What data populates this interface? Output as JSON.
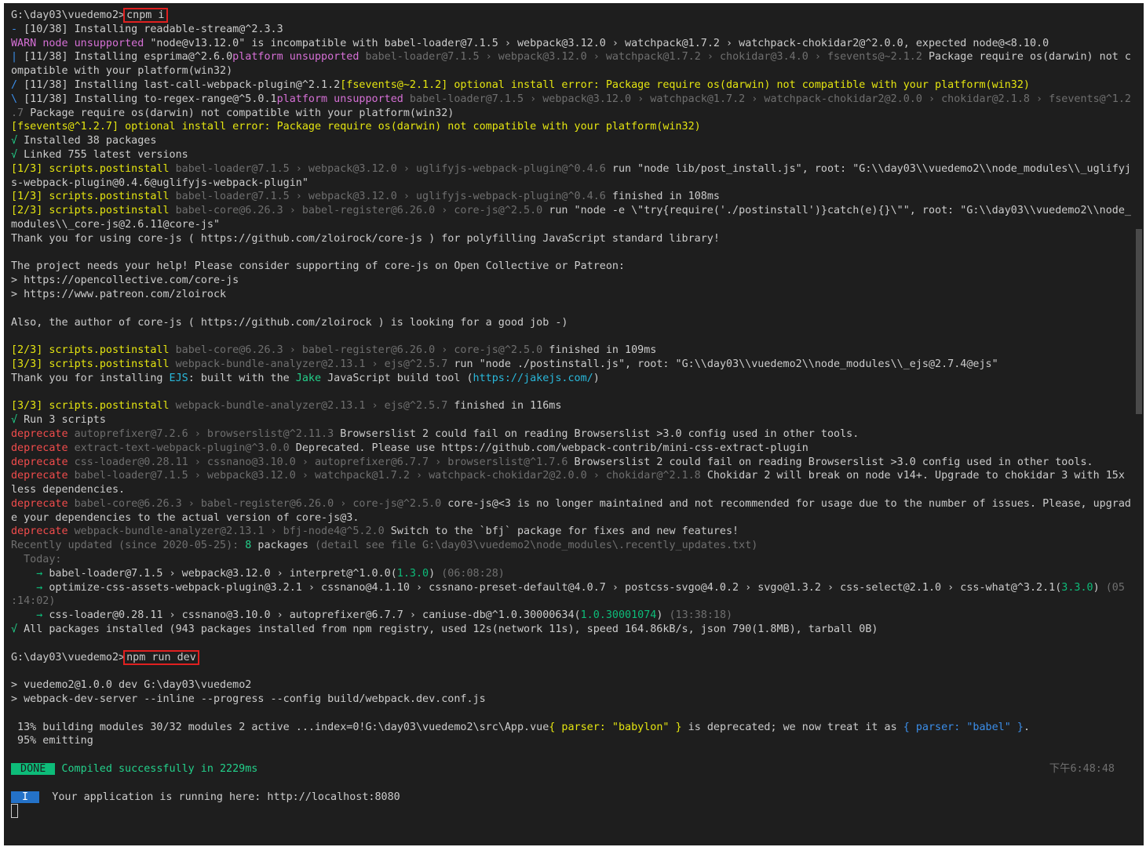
{
  "terminal": {
    "lines": [
      [
        {
          "t": "G:\\day03\\vuedemo2>",
          "c": "w"
        },
        {
          "t": "cnpm i",
          "c": "w",
          "box": true
        }
      ],
      [
        {
          "t": "- ",
          "c": "b"
        },
        {
          "t": "[10/38] Installing readable-stream@^2.3.3",
          "c": "w"
        }
      ],
      [
        {
          "t": "WARN ",
          "c": "m"
        },
        {
          "t": "node ",
          "c": "m"
        },
        {
          "t": "unsupported ",
          "c": "m"
        },
        {
          "t": "\"node@v13.12.0\" is incompatible with babel-loader@7.1.5 › webpack@3.12.0 › watchpack@1.7.2 › watchpack-chokidar2@^2.0.0, expected node@<8.10.0",
          "c": "w"
        }
      ],
      [
        {
          "t": "| ",
          "c": "b"
        },
        {
          "t": "[11/38] Installing esprima@^2.6.0",
          "c": "w"
        },
        {
          "t": "platform unsupported ",
          "c": "m"
        },
        {
          "t": "babel-loader@7.1.5 › webpack@3.12.0 › watchpack@1.7.2 › chokidar@3.4.0 › fsevents@~2.1.2 ",
          "c": "gr"
        },
        {
          "t": "Package require os(darwin) not c",
          "c": "w"
        }
      ],
      [
        {
          "t": "ompatible with your platform(win32)",
          "c": "w"
        }
      ],
      [
        {
          "t": "/ ",
          "c": "b"
        },
        {
          "t": "[11/38] Installing last-call-webpack-plugin@^2.1.2",
          "c": "w"
        },
        {
          "t": "[fsevents@~2.1.2] optional install error: Package require os(darwin) not compatible with your platform(win32)",
          "c": "y"
        }
      ],
      [
        {
          "t": "\\ ",
          "c": "b"
        },
        {
          "t": "[11/38] Installing to-regex-range@^5.0.1",
          "c": "w"
        },
        {
          "t": "platform unsupported ",
          "c": "m"
        },
        {
          "t": "babel-loader@7.1.5 › webpack@3.12.0 › watchpack@1.7.2 › watchpack-chokidar2@2.0.0 › chokidar@2.1.8 › fsevents@^1.2",
          "c": "gr"
        }
      ],
      [
        {
          "t": ".7 ",
          "c": "gr"
        },
        {
          "t": "Package require os(darwin) not compatible with your platform(win32)",
          "c": "w"
        }
      ],
      [
        {
          "t": "[fsevents@^1.2.7] optional install error: Package require os(darwin) not compatible with your platform(win32)",
          "c": "y"
        }
      ],
      [
        {
          "t": "√ ",
          "c": "g"
        },
        {
          "t": "Installed 38 packages",
          "c": "w"
        }
      ],
      [
        {
          "t": "√ ",
          "c": "g"
        },
        {
          "t": "Linked 755 latest versions",
          "c": "w"
        }
      ],
      [
        {
          "t": "[1/3] scripts.postinstall ",
          "c": "y"
        },
        {
          "t": "babel-loader@7.1.5 › webpack@3.12.0 › uglifyjs-webpack-plugin@^0.4.6 ",
          "c": "gr"
        },
        {
          "t": "run \"node lib/post_install.js\", root: \"G:\\\\day03\\\\vuedemo2\\\\node_modules\\\\_uglifyj",
          "c": "w"
        }
      ],
      [
        {
          "t": "s-webpack-plugin@0.4.6@uglifyjs-webpack-plugin\"",
          "c": "w"
        }
      ],
      [
        {
          "t": "[1/3] scripts.postinstall ",
          "c": "y"
        },
        {
          "t": "babel-loader@7.1.5 › webpack@3.12.0 › uglifyjs-webpack-plugin@^0.4.6 ",
          "c": "gr"
        },
        {
          "t": "finished in 108ms",
          "c": "w"
        }
      ],
      [
        {
          "t": "[2/3] scripts.postinstall ",
          "c": "y"
        },
        {
          "t": "babel-core@6.26.3 › babel-register@6.26.0 › core-js@^2.5.0 ",
          "c": "gr"
        },
        {
          "t": "run \"node -e \\\"try{require('./postinstall')}catch(e){}\\\"\", root: \"G:\\\\day03\\\\vuedemo2\\\\node_",
          "c": "w"
        }
      ],
      [
        {
          "t": "modules\\\\_core-js@2.6.11@core-js\"",
          "c": "w"
        }
      ],
      [
        {
          "t": "Thank you for using core-js ( https://github.com/zloirock/core-js ) for polyfilling JavaScript standard library!",
          "c": "w"
        }
      ],
      [],
      [
        {
          "t": "The project needs your help! Please consider supporting of core-js on Open Collective or Patreon:",
          "c": "w"
        }
      ],
      [
        {
          "t": "> https://opencollective.com/core-js",
          "c": "w"
        }
      ],
      [
        {
          "t": "> https://www.patreon.com/zloirock",
          "c": "w"
        }
      ],
      [],
      [
        {
          "t": "Also, the author of core-js ( https://github.com/zloirock ) is looking for a good job -)",
          "c": "w"
        }
      ],
      [],
      [
        {
          "t": "[2/3] scripts.postinstall ",
          "c": "y"
        },
        {
          "t": "babel-core@6.26.3 › babel-register@6.26.0 › core-js@^2.5.0 ",
          "c": "gr"
        },
        {
          "t": "finished in 109ms",
          "c": "w"
        }
      ],
      [
        {
          "t": "[3/3] scripts.postinstall ",
          "c": "y"
        },
        {
          "t": "webpack-bundle-analyzer@2.13.1 › ejs@^2.5.7 ",
          "c": "gr"
        },
        {
          "t": "run \"node ./postinstall.js\", root: \"G:\\\\day03\\\\vuedemo2\\\\node_modules\\\\_ejs@2.7.4@ejs\"",
          "c": "w"
        }
      ],
      [
        {
          "t": "Thank you for installing ",
          "c": "w"
        },
        {
          "t": "EJS",
          "c": "c"
        },
        {
          "t": ": built with the ",
          "c": "w"
        },
        {
          "t": "Jake",
          "c": "g"
        },
        {
          "t": " JavaScript build tool (",
          "c": "w"
        },
        {
          "t": "https://jakejs.com/",
          "c": "c"
        },
        {
          "t": ")",
          "c": "w"
        }
      ],
      [],
      [
        {
          "t": "[3/3] scripts.postinstall ",
          "c": "y"
        },
        {
          "t": "webpack-bundle-analyzer@2.13.1 › ejs@^2.5.7 ",
          "c": "gr"
        },
        {
          "t": "finished in 116ms",
          "c": "w"
        }
      ],
      [
        {
          "t": "√ ",
          "c": "g"
        },
        {
          "t": "Run 3 scripts",
          "c": "w"
        }
      ],
      [
        {
          "t": "deprecate ",
          "c": "r"
        },
        {
          "t": "autoprefixer@7.2.6 › browserslist@^2.11.3 ",
          "c": "gr"
        },
        {
          "t": "Browserslist 2 could fail on reading Browserslist >3.0 config used in other tools.",
          "c": "w"
        }
      ],
      [
        {
          "t": "deprecate ",
          "c": "r"
        },
        {
          "t": "extract-text-webpack-plugin@^3.0.0 ",
          "c": "gr"
        },
        {
          "t": "Deprecated. Please use https://github.com/webpack-contrib/mini-css-extract-plugin",
          "c": "w"
        }
      ],
      [
        {
          "t": "deprecate ",
          "c": "r"
        },
        {
          "t": "css-loader@0.28.11 › cssnano@3.10.0 › autoprefixer@6.7.7 › browserslist@^1.7.6 ",
          "c": "gr"
        },
        {
          "t": "Browserslist 2 could fail on reading Browserslist >3.0 config used in other tools.",
          "c": "w"
        }
      ],
      [
        {
          "t": "deprecate ",
          "c": "r"
        },
        {
          "t": "babel-loader@7.1.5 › webpack@3.12.0 › watchpack@1.7.2 › watchpack-chokidar2@2.0.0 › chokidar@^2.1.8 ",
          "c": "gr"
        },
        {
          "t": "Chokidar 2 will break on node v14+. Upgrade to chokidar 3 with 15x",
          "c": "w"
        }
      ],
      [
        {
          "t": "less dependencies.",
          "c": "w"
        }
      ],
      [
        {
          "t": "deprecate ",
          "c": "r"
        },
        {
          "t": "babel-core@6.26.3 › babel-register@6.26.0 › core-js@^2.5.0 ",
          "c": "gr"
        },
        {
          "t": "core-js@<3 is no longer maintained and not recommended for usage due to the number of issues. Please, upgrad",
          "c": "w"
        }
      ],
      [
        {
          "t": "e your dependencies to the actual version of core-js@3.",
          "c": "w"
        }
      ],
      [
        {
          "t": "deprecate ",
          "c": "r"
        },
        {
          "t": "webpack-bundle-analyzer@2.13.1 › bfj-node4@^5.2.0 ",
          "c": "gr"
        },
        {
          "t": "Switch to the `bfj` package for fixes and new features!",
          "c": "w"
        }
      ],
      [
        {
          "t": "Recently updated (since 2020-05-25): ",
          "c": "gr"
        },
        {
          "t": "8",
          "c": "g"
        },
        {
          "t": " packages ",
          "c": "w"
        },
        {
          "t": "(detail see file G:\\day03\\vuedemo2\\node_modules\\.recently_updates.txt)",
          "c": "gr"
        }
      ],
      [
        {
          "t": "  Today:",
          "c": "gr"
        }
      ],
      [
        {
          "t": "    → ",
          "c": "dg"
        },
        {
          "t": "babel-loader@7.1.5 › webpack@3.12.0 › interpret@^1.0.0(",
          "c": "w"
        },
        {
          "t": "1.3.0",
          "c": "dg"
        },
        {
          "t": ") ",
          "c": "w"
        },
        {
          "t": "(06:08:28)",
          "c": "gr"
        }
      ],
      [
        {
          "t": "    → ",
          "c": "dg"
        },
        {
          "t": "optimize-css-assets-webpack-plugin@3.2.1 › cssnano@4.1.10 › cssnano-preset-default@4.0.7 › postcss-svgo@4.0.2 › svgo@1.3.2 › css-select@2.1.0 › css-what@^3.2.1(",
          "c": "w"
        },
        {
          "t": "3.3.0",
          "c": "dg"
        },
        {
          "t": ") ",
          "c": "w"
        },
        {
          "t": "(05",
          "c": "gr"
        }
      ],
      [
        {
          "t": ":14:02)",
          "c": "gr"
        }
      ],
      [
        {
          "t": "    → ",
          "c": "dg"
        },
        {
          "t": "css-loader@0.28.11 › cssnano@3.10.0 › autoprefixer@6.7.7 › caniuse-db@^1.0.30000634(",
          "c": "w"
        },
        {
          "t": "1.0.30001074",
          "c": "dg"
        },
        {
          "t": ") ",
          "c": "w"
        },
        {
          "t": "(13:38:18)",
          "c": "gr"
        }
      ],
      [
        {
          "t": "√ ",
          "c": "g"
        },
        {
          "t": "All packages installed (943 packages installed from npm registry, used 12s(network 11s), speed 164.86kB/s, json 790(1.8MB), tarball 0B)",
          "c": "w"
        }
      ],
      [],
      [
        {
          "t": "G:\\day03\\vuedemo2>",
          "c": "w"
        },
        {
          "t": "npm run dev",
          "c": "w",
          "box": true
        }
      ],
      [],
      [
        {
          "t": "> vuedemo2@1.0.0 dev G:\\day03\\vuedemo2",
          "c": "w"
        }
      ],
      [
        {
          "t": "> webpack-dev-server --inline --progress --config build/webpack.dev.conf.js",
          "c": "w"
        }
      ],
      [],
      [
        {
          "t": " 13% building modules 30/32 modules 2 active ...index=0!G:\\day03\\vuedemo2\\src\\App.vue",
          "c": "w"
        },
        {
          "t": "{ parser: \"babylon\" }",
          "c": "y"
        },
        {
          "t": " is deprecated; we now treat it as ",
          "c": "w"
        },
        {
          "t": "{ parser: \"babel\" }",
          "c": "b"
        },
        {
          "t": ".",
          "c": "w"
        }
      ],
      [
        {
          "t": " 95% emitting",
          "c": "w"
        }
      ],
      [],
      [
        {
          "t": " DONE ",
          "c": "done"
        },
        {
          "t": " Compiled successfully in 2229ms",
          "c": "g"
        },
        {
          "t": "下午6:48:48",
          "c": "clock"
        }
      ],
      [],
      [
        {
          "t": " I ",
          "c": "info"
        },
        {
          "t": "  Your application is running here: http://localhost:8080",
          "c": "w"
        }
      ],
      [
        {
          "t": "",
          "c": "cursor"
        }
      ]
    ]
  }
}
